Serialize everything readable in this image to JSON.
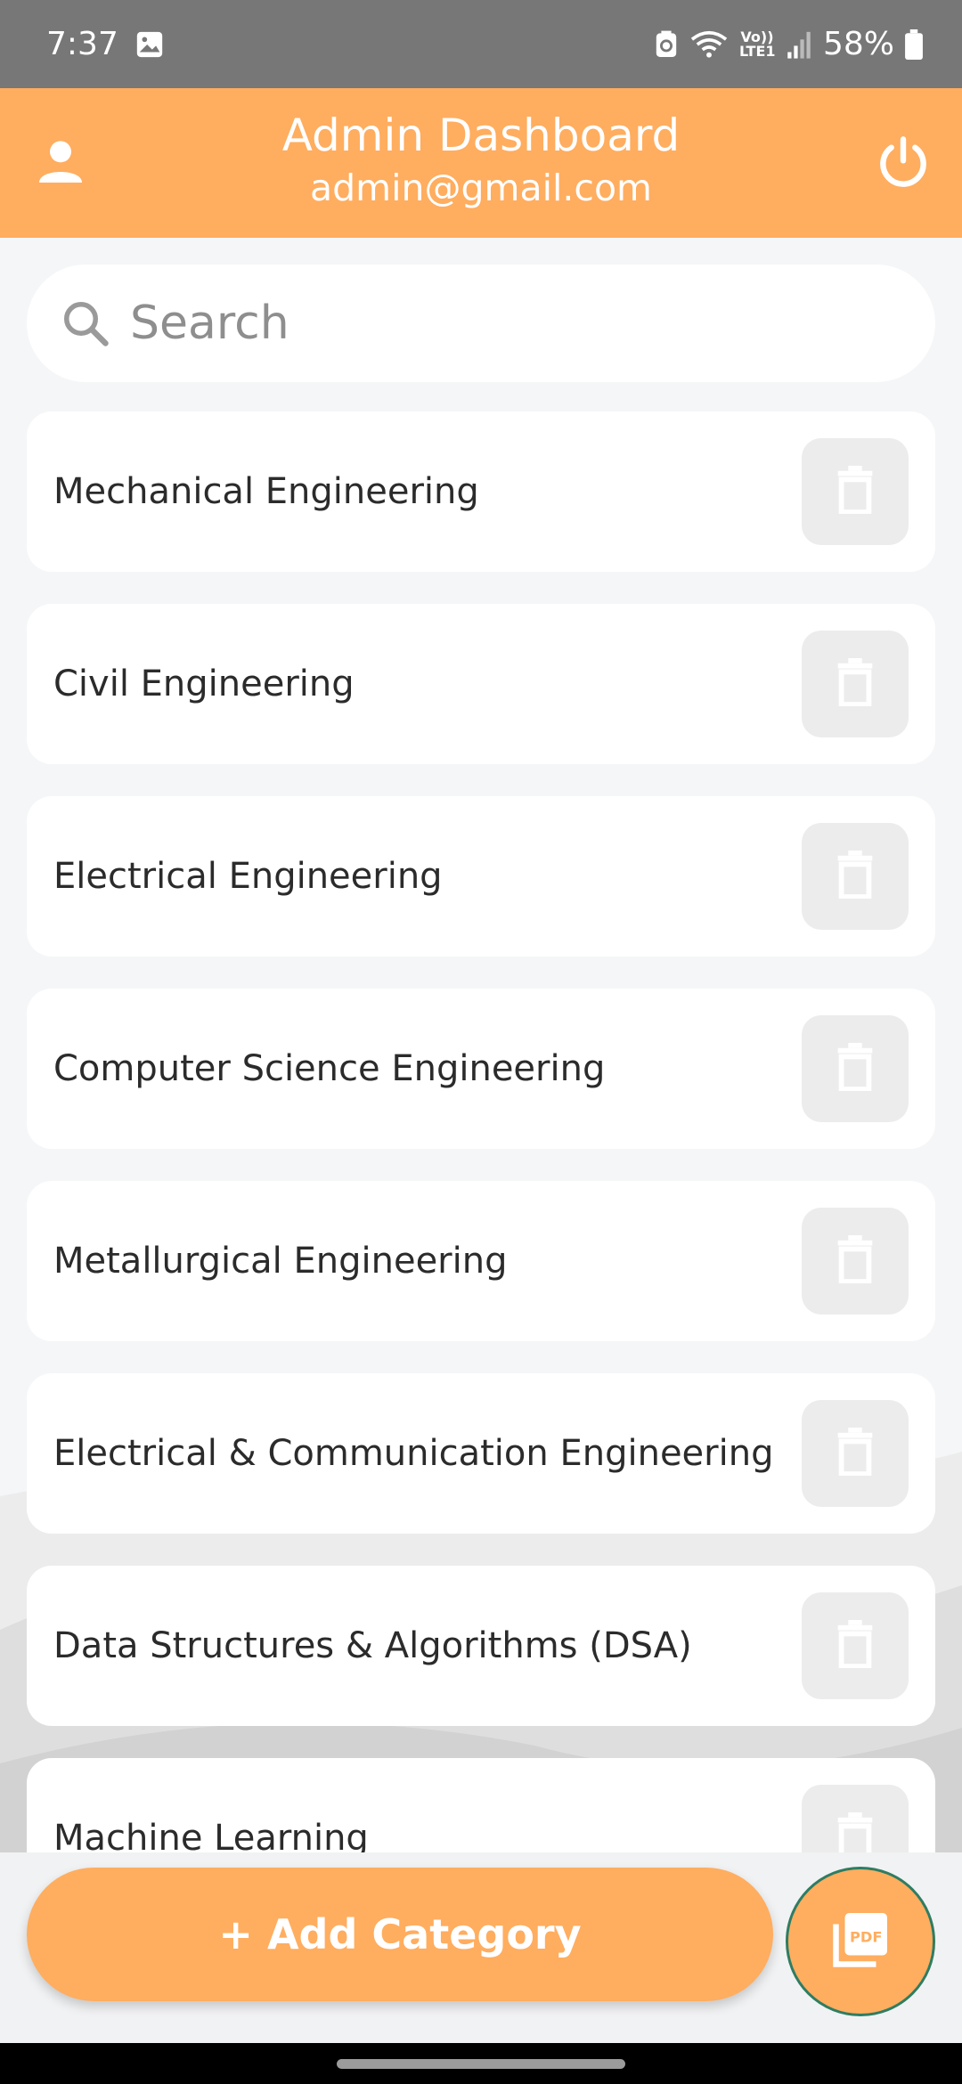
{
  "status_bar": {
    "time": "7:37",
    "battery": "58%",
    "network_label": "Vo)) LTE1",
    "icons": [
      "image-icon",
      "nfc-icon",
      "wifi-icon",
      "signal-icon",
      "battery-icon"
    ]
  },
  "header": {
    "title": "Admin Dashboard",
    "subtitle": "admin@gmail.com",
    "background": "#ffad5f",
    "icons": [
      "profile-icon",
      "power-icon"
    ]
  },
  "search": {
    "placeholder": "Search",
    "value": ""
  },
  "categories": [
    {
      "label": "Mechanical Engineering"
    },
    {
      "label": "Civil Engineering"
    },
    {
      "label": "Electrical Engineering"
    },
    {
      "label": "Computer Science Engineering"
    },
    {
      "label": "Metallurgical Engineering"
    },
    {
      "label": "Electrical & Communication Engineering"
    },
    {
      "label": "Data Structures & Algorithms (DSA)"
    },
    {
      "label": "Machine Learning"
    }
  ],
  "actions": {
    "add_category_label": "+ Add Category",
    "pdf_button_icon": "pdf-icon",
    "accent": "#ffad5f"
  }
}
